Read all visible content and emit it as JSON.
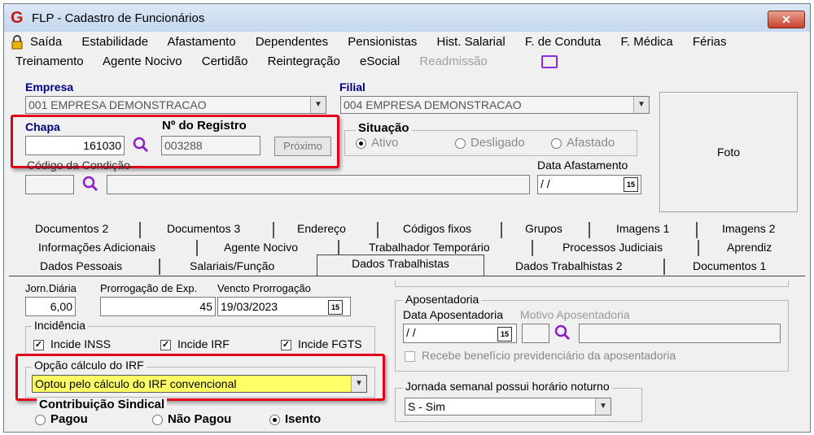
{
  "window": {
    "title": "FLP - Cadastro de Funcionários",
    "close_label": "✕"
  },
  "menu": {
    "row1": [
      "Saída",
      "Estabilidade",
      "Afastamento",
      "Dependentes",
      "Pensionistas",
      "Hist. Salarial",
      "F. de Conduta",
      "F. Médica",
      "Férias"
    ],
    "row2": [
      "Treinamento",
      "Agente Nocivo",
      "Certidão",
      "Reintegração",
      "eSocial",
      "Readmissão"
    ]
  },
  "empresa": {
    "label": "Empresa",
    "value": "001 EMPRESA DEMONSTRACAO"
  },
  "filial": {
    "label": "Filial",
    "value": "004 EMPRESA DEMONSTRACAO"
  },
  "chapa": {
    "label": "Chapa",
    "value": "161030"
  },
  "registro": {
    "label": "Nº do Registro",
    "value": "003288",
    "proximo_label": "Próximo"
  },
  "situacao": {
    "label": "Situação",
    "options": [
      "Ativo",
      "Desligado",
      "Afastado"
    ],
    "selected": "Ativo"
  },
  "foto": {
    "label": "Foto"
  },
  "codigo_condicao": {
    "label": "Código da Condição",
    "value": ""
  },
  "data_afastamento": {
    "label": "Data Afastamento",
    "value": "/ /",
    "cal": "15"
  },
  "tabs": {
    "row1": [
      "Documentos 2",
      "Documentos 3",
      "Endereço",
      "Códigos fixos",
      "Grupos",
      "Imagens 1",
      "Imagens 2"
    ],
    "row2": [
      "Informações Adicionais",
      "Agente Nocivo",
      "Trabalhador Temporário",
      "Processos Judiciais",
      "Aprendiz"
    ],
    "row3": [
      "Dados Pessoais",
      "Salariais/Função",
      "Dados Trabalhistas",
      "Dados Trabalhistas 2",
      "Documentos 1"
    ],
    "active": "Dados Trabalhistas"
  },
  "jornada": {
    "label": "Jorn.Diária",
    "value": "6,00"
  },
  "prorrogacao": {
    "label": "Prorrogação de Exp.",
    "value": "45"
  },
  "vencto": {
    "label": "Vencto Prorrogação",
    "value": "19/03/2023",
    "cal": "15"
  },
  "incidencia": {
    "label": "Incidência",
    "items": [
      "Incide INSS",
      "Incide IRF",
      "Incide FGTS"
    ]
  },
  "irf": {
    "label": "Opção cálculo do IRF",
    "value": "Optou pelo cálculo do IRF convencional"
  },
  "contribuicao": {
    "label": "Contribuição Sindical",
    "options": [
      "Pagou",
      "Não Pagou",
      "Isento"
    ],
    "selected": "Isento"
  },
  "aposentadoria": {
    "label": "Aposentadoria",
    "data_label": "Data Aposentadoria",
    "motivo_label": "Motivo Aposentadoria",
    "data_value": "/ /",
    "cal": "15",
    "beneficio_label": "Recebe benefício previdenciário da aposentadoria"
  },
  "jornada_semanal": {
    "label": "Jornada semanal possui horário noturno",
    "value": "S - Sim"
  },
  "colors": {
    "highlight_red": "#e3001b",
    "irf_yellow": "#ffff66",
    "label_blue": "#000080"
  }
}
